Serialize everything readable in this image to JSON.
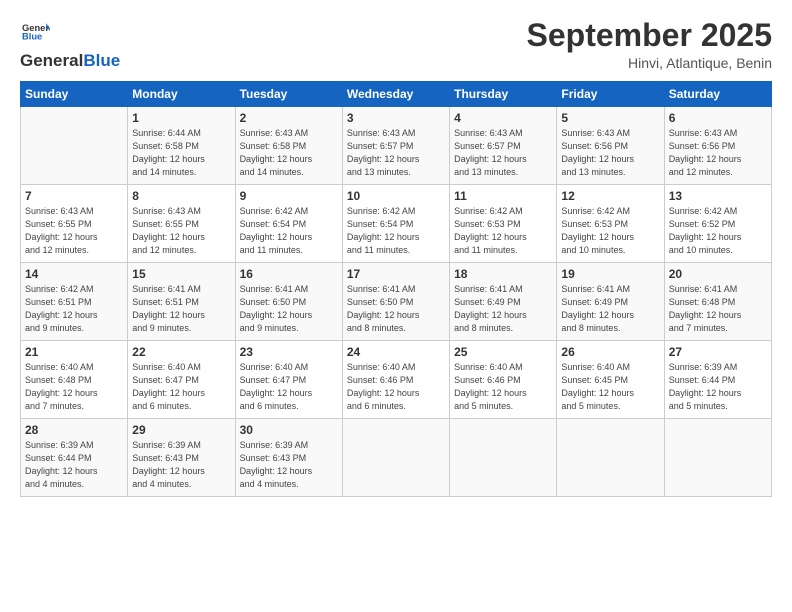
{
  "logo": {
    "line1": "General",
    "line2": "Blue"
  },
  "title": "September 2025",
  "location": "Hinvi, Atlantique, Benin",
  "days_of_week": [
    "Sunday",
    "Monday",
    "Tuesday",
    "Wednesday",
    "Thursday",
    "Friday",
    "Saturday"
  ],
  "weeks": [
    [
      {
        "day": "",
        "info": ""
      },
      {
        "day": "1",
        "info": "Sunrise: 6:44 AM\nSunset: 6:58 PM\nDaylight: 12 hours\nand 14 minutes."
      },
      {
        "day": "2",
        "info": "Sunrise: 6:43 AM\nSunset: 6:58 PM\nDaylight: 12 hours\nand 14 minutes."
      },
      {
        "day": "3",
        "info": "Sunrise: 6:43 AM\nSunset: 6:57 PM\nDaylight: 12 hours\nand 13 minutes."
      },
      {
        "day": "4",
        "info": "Sunrise: 6:43 AM\nSunset: 6:57 PM\nDaylight: 12 hours\nand 13 minutes."
      },
      {
        "day": "5",
        "info": "Sunrise: 6:43 AM\nSunset: 6:56 PM\nDaylight: 12 hours\nand 13 minutes."
      },
      {
        "day": "6",
        "info": "Sunrise: 6:43 AM\nSunset: 6:56 PM\nDaylight: 12 hours\nand 12 minutes."
      }
    ],
    [
      {
        "day": "7",
        "info": "Sunrise: 6:43 AM\nSunset: 6:55 PM\nDaylight: 12 hours\nand 12 minutes."
      },
      {
        "day": "8",
        "info": "Sunrise: 6:43 AM\nSunset: 6:55 PM\nDaylight: 12 hours\nand 12 minutes."
      },
      {
        "day": "9",
        "info": "Sunrise: 6:42 AM\nSunset: 6:54 PM\nDaylight: 12 hours\nand 11 minutes."
      },
      {
        "day": "10",
        "info": "Sunrise: 6:42 AM\nSunset: 6:54 PM\nDaylight: 12 hours\nand 11 minutes."
      },
      {
        "day": "11",
        "info": "Sunrise: 6:42 AM\nSunset: 6:53 PM\nDaylight: 12 hours\nand 11 minutes."
      },
      {
        "day": "12",
        "info": "Sunrise: 6:42 AM\nSunset: 6:53 PM\nDaylight: 12 hours\nand 10 minutes."
      },
      {
        "day": "13",
        "info": "Sunrise: 6:42 AM\nSunset: 6:52 PM\nDaylight: 12 hours\nand 10 minutes."
      }
    ],
    [
      {
        "day": "14",
        "info": "Sunrise: 6:42 AM\nSunset: 6:51 PM\nDaylight: 12 hours\nand 9 minutes."
      },
      {
        "day": "15",
        "info": "Sunrise: 6:41 AM\nSunset: 6:51 PM\nDaylight: 12 hours\nand 9 minutes."
      },
      {
        "day": "16",
        "info": "Sunrise: 6:41 AM\nSunset: 6:50 PM\nDaylight: 12 hours\nand 9 minutes."
      },
      {
        "day": "17",
        "info": "Sunrise: 6:41 AM\nSunset: 6:50 PM\nDaylight: 12 hours\nand 8 minutes."
      },
      {
        "day": "18",
        "info": "Sunrise: 6:41 AM\nSunset: 6:49 PM\nDaylight: 12 hours\nand 8 minutes."
      },
      {
        "day": "19",
        "info": "Sunrise: 6:41 AM\nSunset: 6:49 PM\nDaylight: 12 hours\nand 8 minutes."
      },
      {
        "day": "20",
        "info": "Sunrise: 6:41 AM\nSunset: 6:48 PM\nDaylight: 12 hours\nand 7 minutes."
      }
    ],
    [
      {
        "day": "21",
        "info": "Sunrise: 6:40 AM\nSunset: 6:48 PM\nDaylight: 12 hours\nand 7 minutes."
      },
      {
        "day": "22",
        "info": "Sunrise: 6:40 AM\nSunset: 6:47 PM\nDaylight: 12 hours\nand 6 minutes."
      },
      {
        "day": "23",
        "info": "Sunrise: 6:40 AM\nSunset: 6:47 PM\nDaylight: 12 hours\nand 6 minutes."
      },
      {
        "day": "24",
        "info": "Sunrise: 6:40 AM\nSunset: 6:46 PM\nDaylight: 12 hours\nand 6 minutes."
      },
      {
        "day": "25",
        "info": "Sunrise: 6:40 AM\nSunset: 6:46 PM\nDaylight: 12 hours\nand 5 minutes."
      },
      {
        "day": "26",
        "info": "Sunrise: 6:40 AM\nSunset: 6:45 PM\nDaylight: 12 hours\nand 5 minutes."
      },
      {
        "day": "27",
        "info": "Sunrise: 6:39 AM\nSunset: 6:44 PM\nDaylight: 12 hours\nand 5 minutes."
      }
    ],
    [
      {
        "day": "28",
        "info": "Sunrise: 6:39 AM\nSunset: 6:44 PM\nDaylight: 12 hours\nand 4 minutes."
      },
      {
        "day": "29",
        "info": "Sunrise: 6:39 AM\nSunset: 6:43 PM\nDaylight: 12 hours\nand 4 minutes."
      },
      {
        "day": "30",
        "info": "Sunrise: 6:39 AM\nSunset: 6:43 PM\nDaylight: 12 hours\nand 4 minutes."
      },
      {
        "day": "",
        "info": ""
      },
      {
        "day": "",
        "info": ""
      },
      {
        "day": "",
        "info": ""
      },
      {
        "day": "",
        "info": ""
      }
    ]
  ]
}
